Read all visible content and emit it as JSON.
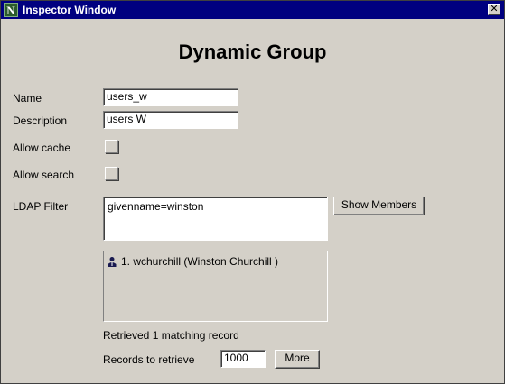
{
  "window": {
    "title": "Inspector Window",
    "close_glyph": "✕"
  },
  "heading": "Dynamic Group",
  "fields": {
    "name_label": "Name",
    "name_value": "users_w",
    "description_label": "Description",
    "description_value": "users W",
    "allow_cache_label": "Allow cache",
    "allow_search_label": "Allow search",
    "ldap_filter_label": "LDAP Filter",
    "ldap_filter_value": "givenname=winston"
  },
  "buttons": {
    "show_members": "Show Members",
    "more": "More"
  },
  "members": [
    {
      "icon": "user-icon",
      "text": "1. wchurchill (Winston Churchill )"
    }
  ],
  "status": "Retrieved 1 matching record",
  "records": {
    "label": "Records to retrieve",
    "value": "1000"
  },
  "colors": {
    "titlebar": "#000080",
    "background": "#d4d0c8"
  }
}
